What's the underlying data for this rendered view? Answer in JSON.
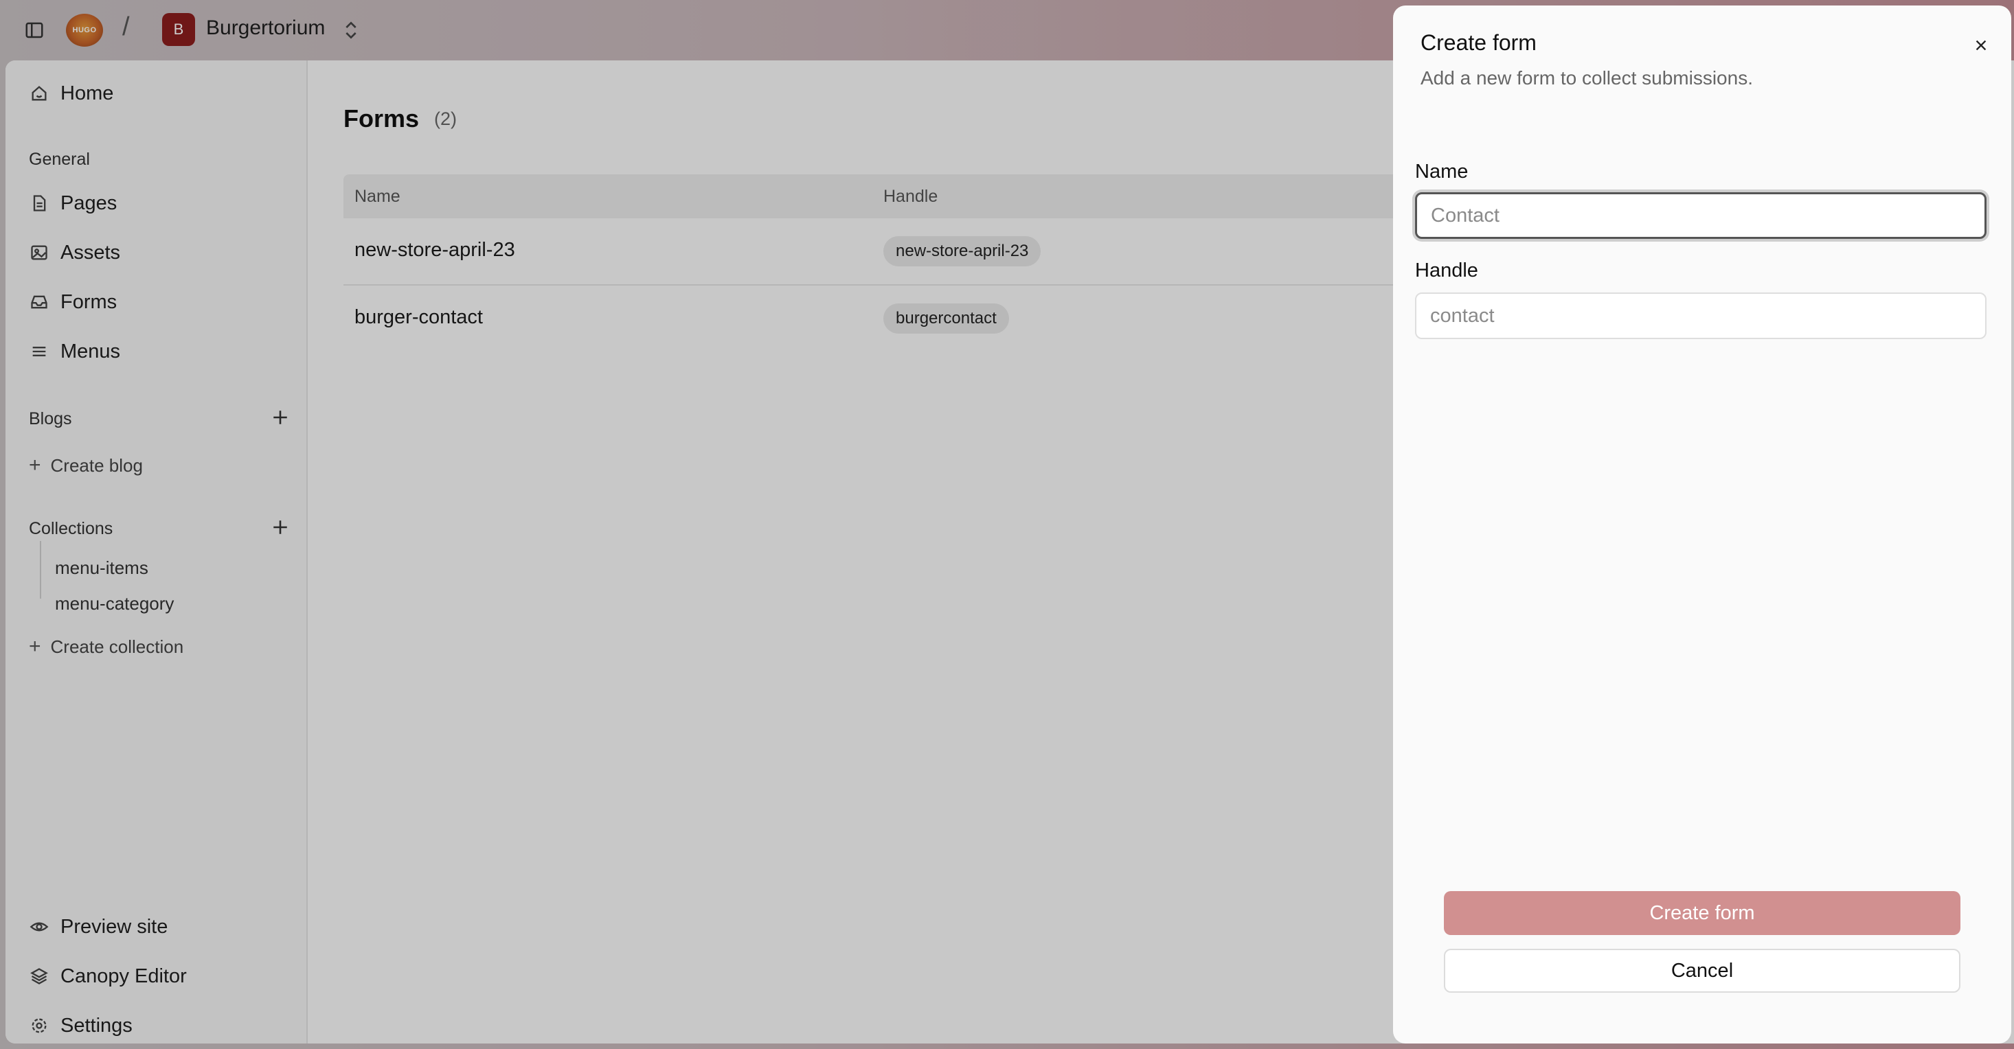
{
  "topbar": {
    "logo_text": "HUGO",
    "separator": "/",
    "site_initial": "B",
    "site_name": "Burgertorium"
  },
  "sidebar": {
    "home": "Home",
    "general_title": "General",
    "general_items": [
      "Pages",
      "Assets",
      "Forms",
      "Menus"
    ],
    "blogs_title": "Blogs",
    "create_blog": "Create blog",
    "collections_title": "Collections",
    "collections": [
      "menu-items",
      "menu-category"
    ],
    "create_collection": "Create collection",
    "bottom_items": [
      "Preview site",
      "Canopy Editor",
      "Settings"
    ]
  },
  "main": {
    "title": "Forms",
    "count": "(2)",
    "columns": [
      "Name",
      "Handle"
    ],
    "rows": [
      {
        "name": "new-store-april-23",
        "handle": "new-store-april-23"
      },
      {
        "name": "burger-contact",
        "handle": "burgercontact"
      }
    ]
  },
  "dialog": {
    "title": "Create form",
    "subtitle": "Add a new form to collect submissions.",
    "name_label": "Name",
    "name_placeholder": "Contact",
    "handle_label": "Handle",
    "handle_placeholder": "contact",
    "submit": "Create form",
    "cancel": "Cancel"
  },
  "icons": [
    "sidebar-toggle-icon",
    "chevron-updown-icon",
    "home-icon",
    "page-icon",
    "image-icon",
    "inbox-icon",
    "menu-icon",
    "plus-icon",
    "eye-icon",
    "layers-icon",
    "gear-icon",
    "close-icon"
  ],
  "colors": {
    "primary_button": "#d19090",
    "site_avatar": "#8b1d1d"
  }
}
